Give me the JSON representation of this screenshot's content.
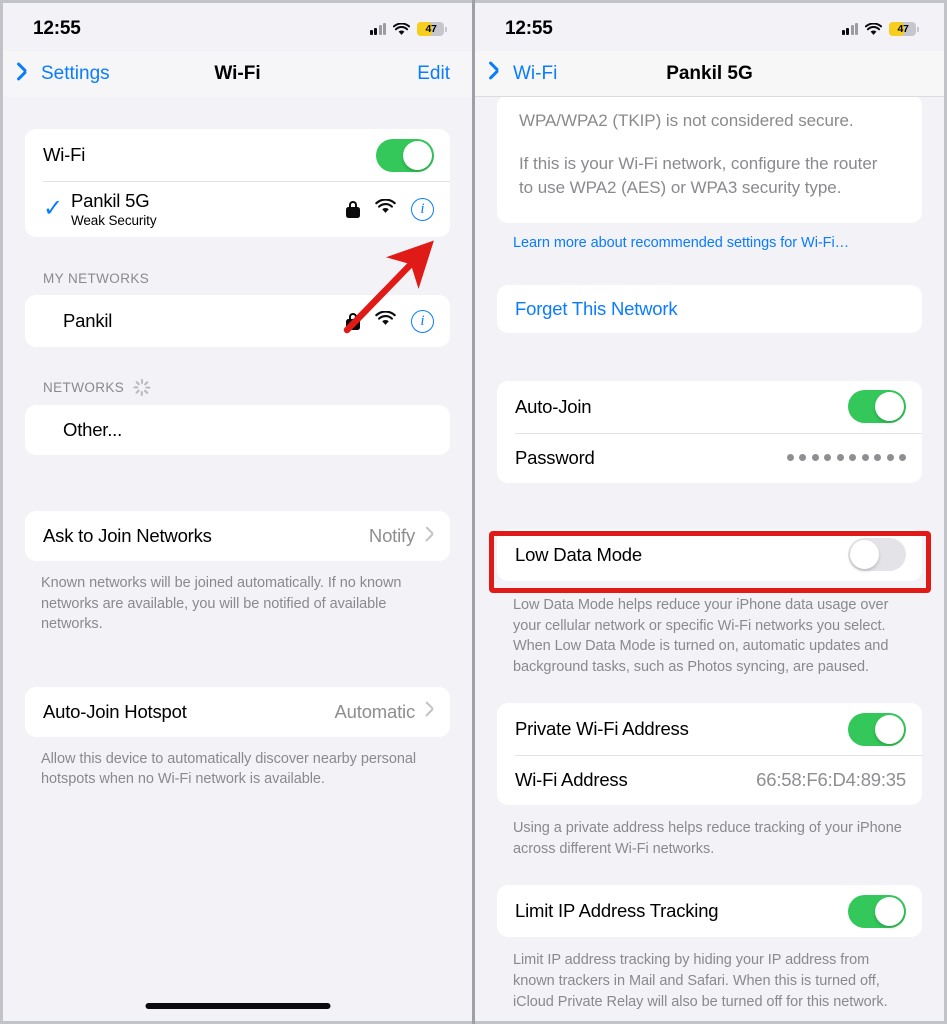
{
  "theme": {
    "accent_blue": "#0a7cff",
    "toggle_on_green": "#34c759",
    "annotation_red": "#e01b17",
    "page_background": "#f2f2f7",
    "card_background": "#ffffff",
    "secondary_text": "#8a8a8e"
  },
  "left_panel": {
    "status_bar": {
      "time": "12:55",
      "battery_percent": "47"
    },
    "nav": {
      "back_label": "Settings",
      "title": "Wi-Fi",
      "right_action": "Edit"
    },
    "wifi_card": {
      "wifi_row_label": "Wi-Fi",
      "wifi_toggle_state": "on",
      "connected_network": {
        "name": "Pankil 5G",
        "subtitle": "Weak Security",
        "checked": true,
        "secured": true
      }
    },
    "my_networks": {
      "header": "MY NETWORKS",
      "items": [
        {
          "name": "Pankil",
          "secured": true
        }
      ]
    },
    "networks": {
      "header": "NETWORKS",
      "scanning": true,
      "items": [
        {
          "name": "Other..."
        }
      ]
    },
    "ask_to_join": {
      "label": "Ask to Join Networks",
      "value": "Notify",
      "footnote": "Known networks will be joined automatically. If no known networks are available, you will be notified of available networks."
    },
    "auto_join_hotspot": {
      "label": "Auto-Join Hotspot",
      "value": "Automatic",
      "footnote": "Allow this device to automatically discover nearby personal hotspots when no Wi-Fi network is available."
    }
  },
  "right_panel": {
    "status_bar": {
      "time": "12:55",
      "battery_percent": "47"
    },
    "nav": {
      "back_label": "Wi-Fi",
      "title": "Pankil 5G"
    },
    "security_note": {
      "clipped_line": "WPA/WPA2 (TKIP) is not considered secure.",
      "body": "If this is your Wi-Fi network, configure the router to use WPA2 (AES) or WPA3 security type.",
      "link": "Learn more about recommended settings for Wi-Fi…"
    },
    "forget_network": {
      "label": "Forget This Network"
    },
    "join_card": {
      "auto_join": {
        "label": "Auto-Join",
        "state": "on"
      },
      "password": {
        "label": "Password",
        "masked_value": "••••••••••"
      }
    },
    "low_data_mode": {
      "label": "Low Data Mode",
      "state": "off",
      "highlighted": true,
      "footnote": "Low Data Mode helps reduce your iPhone data usage over your cellular network or specific Wi-Fi networks you select. When Low Data Mode is turned on, automatic updates and background tasks, such as Photos syncing, are paused."
    },
    "private_address": {
      "toggle_label": "Private Wi-Fi Address",
      "toggle_state": "on",
      "address_label": "Wi-Fi Address",
      "address_value": "66:58:F6:D4:89:35",
      "footnote": "Using a private address helps reduce tracking of your iPhone across different Wi-Fi networks."
    },
    "limit_ip": {
      "label": "Limit IP Address Tracking",
      "state": "on",
      "footnote": "Limit IP address tracking by hiding your IP address from known trackers in Mail and Safari. When this is turned off, iCloud Private Relay will also be turned off for this network."
    }
  }
}
